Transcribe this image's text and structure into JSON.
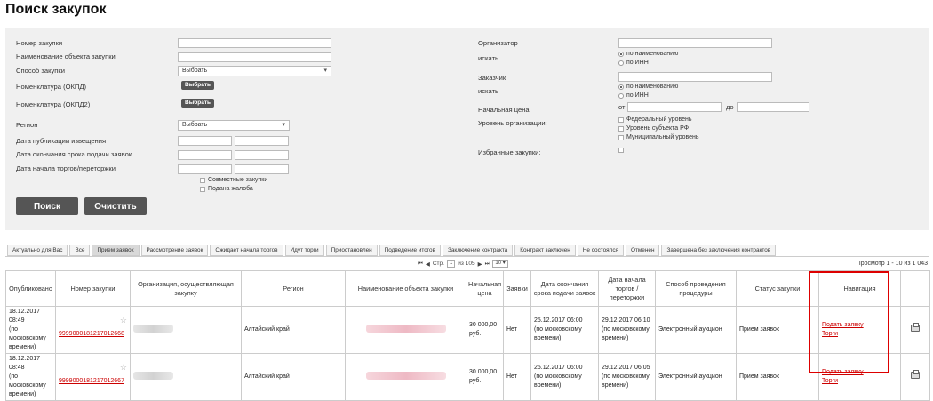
{
  "title": "Поиск закупок",
  "form": {
    "left_labels": [
      "Номер закупки",
      "Наименование объекта закупки",
      "Способ закупки",
      "Номенклатура (ОКПД)",
      "Номенклатура (ОКПД2)",
      "Регион",
      "Дата публикации извещения",
      "Дата окончания срока подачи заявок",
      "Дата начала торгов/переторжки"
    ],
    "method_select": "Выбрать",
    "region_select": "Выбрать",
    "pick_label": "Выбрать",
    "joint_purchases": "Совместные закупки",
    "complaint_filed": "Подана жалоба",
    "organizer_label": "Организатор",
    "search_by_label": "искать",
    "by_name": "по наименованию",
    "by_inn": "по ИНН",
    "customer_label": "Заказчик",
    "start_price_label": "Начальная цена",
    "from_label": "от",
    "to_label": "до",
    "org_level_label": "Уровень организации:",
    "levels": [
      "Федеральный уровень",
      "Уровень субъекта РФ",
      "Муниципальный уровень"
    ],
    "favorites_label": "Избранные закупки:",
    "search_button": "Поиск",
    "clear_button": "Очистить"
  },
  "tabs": [
    "Актуально для Вас",
    "Все",
    "Прием заявок",
    "Рассмотрение заявок",
    "Ожидает начала торгов",
    "Идут торги",
    "Приостановлен",
    "Подведение итогов",
    "Заключение контракта",
    "Контракт заключен",
    "Не состоялся",
    "Отменен",
    "Завершена без заключения контрактов"
  ],
  "active_tab": "Прием заявок",
  "pager": {
    "page_label": "Стр.",
    "page": "1",
    "of_label": "из 105",
    "per_page": "10",
    "view_text": "Просмотр 1 - 10 из 1 043"
  },
  "table": {
    "headers": [
      "Опубликовано",
      "Номер закупки",
      "Организация, осуществляющая закупку",
      "Регион",
      "Наименование объекта закупки",
      "Начальная цена",
      "Заявки",
      "Дата окончания срока подачи заявок",
      "Дата начала торгов / переторжки",
      "Способ проведения процедуры",
      "Статус закупки",
      "Навигация"
    ],
    "rows": [
      {
        "published": "18.12.2017 08:49",
        "published_note": "(по московскому времени)",
        "number": "9999000181217012668",
        "region": "Алтайский край",
        "price": "30 000,00 руб.",
        "bids": "Нет",
        "deadline": "25.12.2017 06:00",
        "deadline_note": "(по московскому времени)",
        "auction_start": "29.12.2017 06:10",
        "auction_note": "(по московскому времени)",
        "method": "Электронный аукцион",
        "status": "Прием заявок",
        "nav_apply": "Подать заявку",
        "nav_trade": "Торги"
      },
      {
        "published": "18.12.2017 08:48",
        "published_note": "(по московскому времени)",
        "number": "9999000181217012667",
        "region": "Алтайский край",
        "price": "30 000,00 руб.",
        "bids": "Нет",
        "deadline": "25.12.2017 06:00",
        "deadline_note": "(по московскому времени)",
        "auction_start": "29.12.2017 06:05",
        "auction_note": "(по московскому времени)",
        "method": "Электронный аукцион",
        "status": "Прием заявок",
        "nav_apply": "Подать заявку",
        "nav_trade": "Торги"
      }
    ]
  },
  "colors": {
    "link": "#cc0000",
    "highlight": "#dd0000",
    "button": "#555555"
  }
}
